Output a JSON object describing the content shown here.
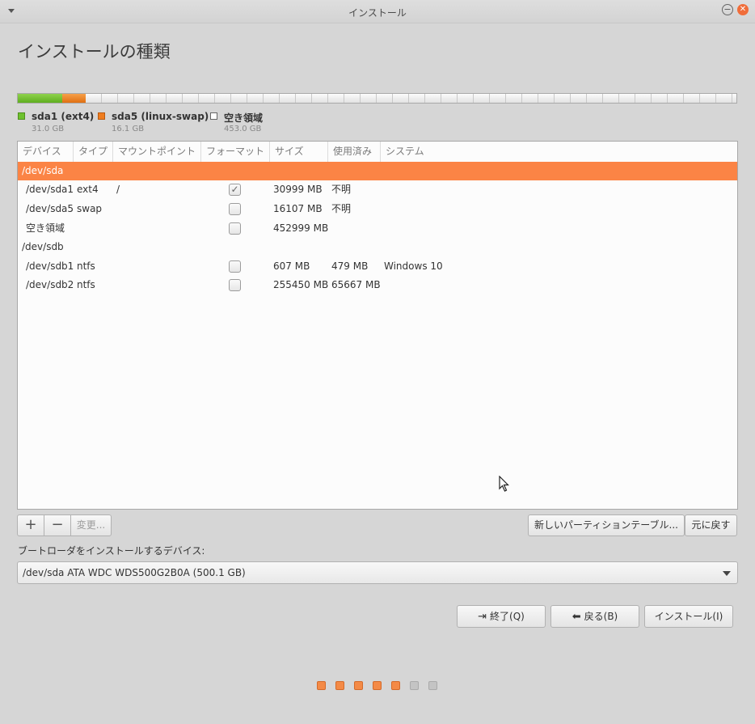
{
  "window": {
    "title": "インストール"
  },
  "page": {
    "title": "インストールの種類"
  },
  "colors": {
    "ext4": "#6ec12e",
    "swap": "#ef7d1f",
    "selected_row": "#fb8445",
    "progress_on": "#f48a46",
    "progress_off": "#c4c4c4"
  },
  "legend": [
    {
      "name": "sda1 (ext4)",
      "size": "31.0 GB"
    },
    {
      "name": "sda5 (linux-swap)",
      "size": "16.1 GB"
    },
    {
      "name": "空き領域",
      "size": "453.0 GB"
    }
  ],
  "table": {
    "headers": [
      "デバイス",
      "タイプ",
      "マウントポイント",
      "フォーマット",
      "サイズ",
      "使用済み",
      "システム"
    ],
    "rows": [
      {
        "device": "/dev/sda",
        "group": true,
        "selected": true
      },
      {
        "device": "/dev/sda1",
        "type": "ext4",
        "mount": "/",
        "format": true,
        "size": "30999 MB",
        "used": "不明",
        "system": ""
      },
      {
        "device": "/dev/sda5",
        "type": "swap",
        "mount": "",
        "format": false,
        "size": "16107 MB",
        "used": "不明",
        "system": ""
      },
      {
        "device": "空き領域",
        "type": "",
        "mount": "",
        "format": false,
        "size": "452999 MB",
        "used": "",
        "system": ""
      },
      {
        "device": "/dev/sdb",
        "group": true,
        "selected": false
      },
      {
        "device": "/dev/sdb1",
        "type": "ntfs",
        "mount": "",
        "format": false,
        "size": "607 MB",
        "used": "479 MB",
        "system": "Windows 10"
      },
      {
        "device": "/dev/sdb2",
        "type": "ntfs",
        "mount": "",
        "format": false,
        "size": "255450 MB",
        "used": "65667 MB",
        "system": ""
      }
    ]
  },
  "toolbar": {
    "add": "+",
    "remove": "−",
    "change": "変更...",
    "new_table": "新しいパーティションテーブル...",
    "revert": "元に戻す"
  },
  "bootloader": {
    "label": "ブートローダをインストールするデバイス:",
    "selected": "/dev/sda   ATA WDC WDS500G2B0A (500.1 GB)"
  },
  "nav": {
    "quit": "終了(Q)",
    "back": "戻る(B)",
    "install": "インストール(I)"
  },
  "progress": {
    "total_steps": 7,
    "completed_steps": 5
  }
}
